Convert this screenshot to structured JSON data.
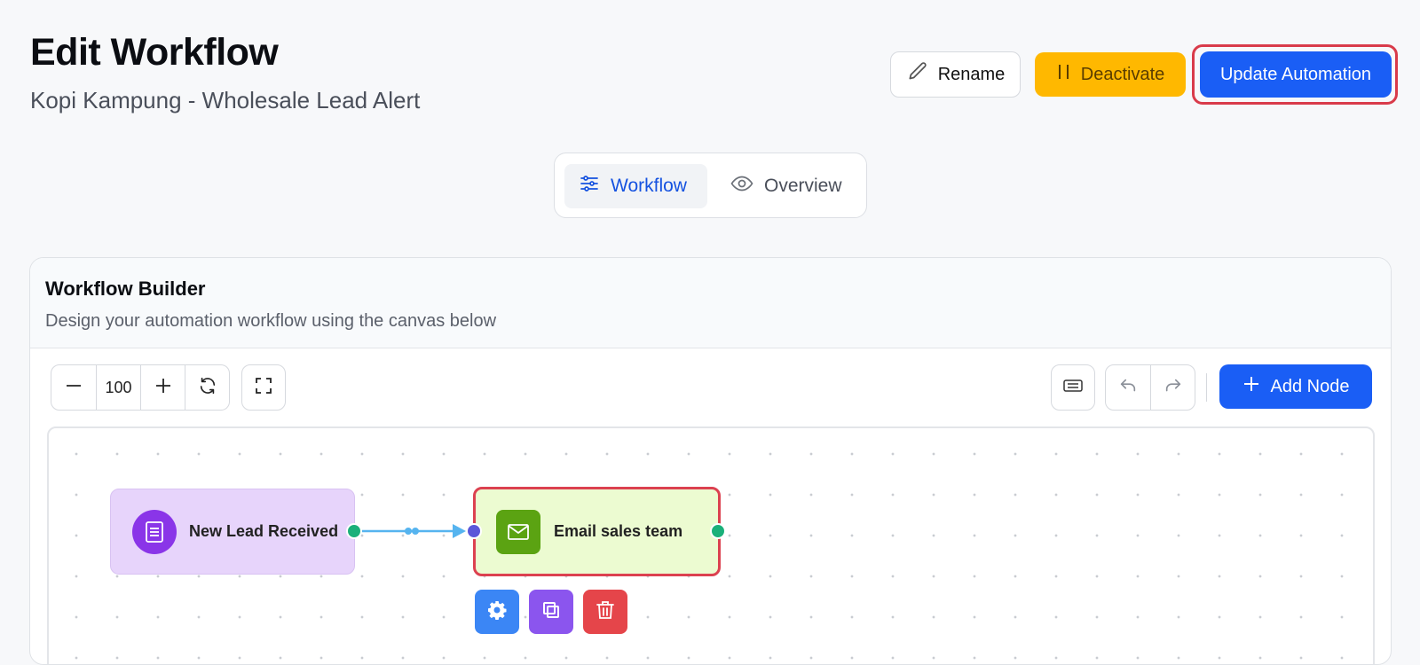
{
  "header": {
    "title": "Edit Workflow",
    "subtitle": "Kopi Kampung - Wholesale Lead Alert"
  },
  "actions": {
    "rename_label": "Rename",
    "deactivate_label": "Deactivate",
    "update_label": "Update Automation"
  },
  "tabs": [
    {
      "label": "Workflow",
      "icon": "sliders-icon",
      "active": true
    },
    {
      "label": "Overview",
      "icon": "eye-icon",
      "active": false
    }
  ],
  "builder": {
    "title": "Workflow Builder",
    "description": "Design your automation workflow using the canvas below",
    "zoom": "100",
    "add_node_label": "Add Node"
  },
  "nodes": [
    {
      "label": "New Lead Received",
      "type": "trigger",
      "icon": "form-icon",
      "color": "#8a35e8"
    },
    {
      "label": "Email sales team",
      "type": "action",
      "icon": "mail-icon",
      "color": "#5ba312",
      "selected": true
    }
  ],
  "colors": {
    "primary": "#1a5ef5",
    "warning": "#ffb800",
    "highlight": "#dc4150"
  }
}
